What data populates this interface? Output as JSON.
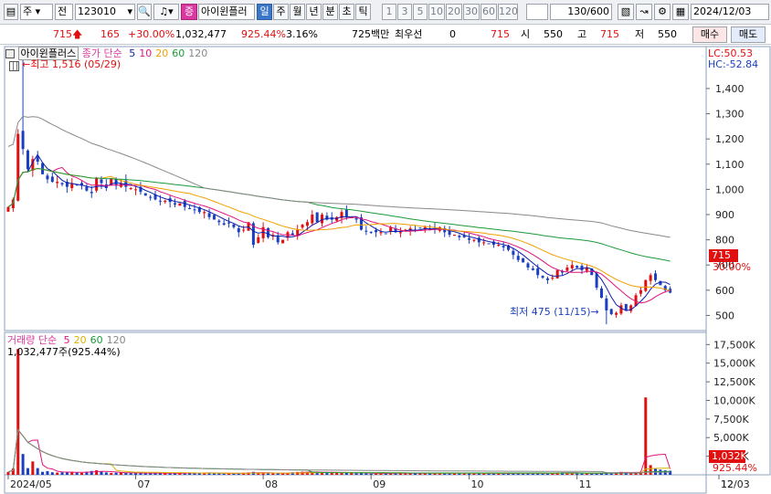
{
  "toolbar": {
    "mode1": "주",
    "mode2": "전",
    "code": "123010",
    "market_badge": "증",
    "name": "아이윈플러",
    "periods": [
      "일",
      "주",
      "월",
      "년",
      "분",
      "초",
      "틱"
    ],
    "active_period": "일",
    "intervals": [
      "1",
      "3",
      "5",
      "10",
      "20",
      "30",
      "60",
      "120"
    ],
    "count": "130/600",
    "date": "2024/12/03"
  },
  "quote": {
    "price": "715",
    "change": "165",
    "change_pct": "+30.00%",
    "volume": "1,032,477",
    "volume_ratio": "925.44%",
    "turnover_rate": "3.16%",
    "amount": "725백만",
    "pref_label": "최우선",
    "pref_value": "0",
    "ask": "715",
    "open_label": "시",
    "open": "550",
    "high_label": "고",
    "high": "715",
    "low_label": "저",
    "low": "550",
    "buy": "매수",
    "sell": "매도"
  },
  "price_legend": {
    "name": "아이윈플러스",
    "ma_label": "종가 단순",
    "ma": [
      {
        "period": "5",
        "color": "#0f1fb0"
      },
      {
        "period": "10",
        "color": "#e0157a"
      },
      {
        "period": "20",
        "color": "#f0a000"
      },
      {
        "period": "60",
        "color": "#1a9a3a"
      },
      {
        "period": "120",
        "color": "#888888"
      }
    ],
    "lc": "LC:50.53",
    "hc": "HC:-52.84",
    "high_note": "최고 1,516 (05/29)",
    "low_note": "최저 475 (11/15)",
    "last_price": "715",
    "last_pct": "30.00%"
  },
  "volume_legend": {
    "label": "거래량",
    "ma_label": "단순",
    "ma": [
      {
        "period": "5",
        "color": "#e0157a"
      },
      {
        "period": "20",
        "color": "#d9b400"
      },
      {
        "period": "60",
        "color": "#1a9a3a"
      },
      {
        "period": "120",
        "color": "#888888"
      }
    ],
    "current": "1,032,477주(925.44%)",
    "last_volume": "1,032K",
    "last_pct": "925.44%"
  },
  "colors": {
    "up": "#e01010",
    "down": "#1a3fc0",
    "panel_border": "#8fa0bc"
  },
  "chart_data": {
    "type": "candlestick",
    "price_axis": {
      "ticks": [
        500,
        600,
        700,
        800,
        900,
        1000,
        1100,
        1200,
        1300,
        1400
      ],
      "labels": [
        "500",
        "600",
        "700",
        "800",
        "900",
        "1,000",
        "1,100",
        "1,200",
        "1,300",
        "1,400"
      ],
      "range": [
        440,
        1570
      ]
    },
    "volume_axis": {
      "ticks": [
        0,
        2500,
        5000,
        7500,
        10000,
        12500,
        15000,
        17500
      ],
      "labels": [
        "0",
        "2,500K",
        "5,000K",
        "7,500K",
        "10,000K",
        "12,500K",
        "15,000K",
        "17,500K"
      ],
      "range": [
        0,
        18400
      ]
    },
    "x_labels": [
      "2024/05",
      "07",
      "08",
      "09",
      "10",
      "11",
      "12",
      "12/03"
    ],
    "x_label_index": [
      0,
      26,
      52,
      74,
      94,
      116,
      136,
      148
    ],
    "n": 136,
    "high_index": 3,
    "high_value": 1516,
    "low_index": 122,
    "low_value": 475,
    "close": [
      930,
      960,
      1220,
      1160,
      1080,
      1120,
      1110,
      1060,
      1040,
      1030,
      1030,
      1020,
      1010,
      1025,
      1015,
      1015,
      995,
      985,
      1045,
      1025,
      1005,
      1045,
      1015,
      1025,
      1010,
      1005,
      1000,
      990,
      975,
      970,
      960,
      955,
      955,
      950,
      940,
      945,
      930,
      925,
      920,
      910,
      910,
      890,
      880,
      870,
      860,
      865,
      850,
      830,
      840,
      870,
      780,
      810,
      850,
      810,
      820,
      790,
      800,
      830,
      820,
      840,
      860,
      870,
      900,
      870,
      900,
      880,
      880,
      890,
      910,
      890,
      890,
      880,
      840,
      835,
      830,
      830,
      830,
      825,
      850,
      830,
      830,
      840,
      845,
      840,
      845,
      850,
      840,
      840,
      850,
      830,
      820,
      820,
      810,
      810,
      800,
      800,
      790,
      790,
      785,
      780,
      780,
      770,
      760,
      740,
      720,
      710,
      690,
      680,
      660,
      650,
      640,
      650,
      680,
      670,
      690,
      700,
      690,
      680,
      690,
      660,
      610,
      570,
      520,
      505,
      510,
      540,
      520,
      540,
      580,
      600,
      640,
      660,
      640,
      620,
      600,
      590,
      560,
      715
    ],
    "volume": [
      380,
      850,
      16900,
      2800,
      900,
      1800,
      900,
      400,
      500,
      340,
      300,
      340,
      380,
      420,
      300,
      260,
      420,
      520,
      620,
      430,
      320,
      260,
      280,
      320,
      260,
      230,
      220,
      280,
      200,
      220,
      240,
      220,
      180,
      200,
      190,
      220,
      230,
      300,
      250,
      240,
      230,
      260,
      250,
      190,
      170,
      200,
      200,
      210,
      240,
      330,
      400,
      230,
      250,
      220,
      200,
      210,
      200,
      210,
      340,
      380,
      420,
      400,
      380,
      300,
      270,
      380,
      380,
      300,
      260,
      300,
      250,
      220,
      260,
      180,
      140,
      180,
      220,
      200,
      230,
      220,
      210,
      220,
      240,
      220,
      240,
      220,
      200,
      200,
      220,
      240,
      210,
      240,
      260,
      220,
      200,
      180,
      200,
      210,
      200,
      180,
      170,
      160,
      190,
      230,
      260,
      200,
      190,
      200,
      210,
      190,
      220,
      230,
      320,
      330,
      260,
      230,
      200,
      180,
      200,
      190,
      240,
      280,
      320,
      260,
      300,
      400,
      310,
      280,
      300,
      420,
      10400,
      1300,
      800,
      700,
      600,
      550,
      480,
      1032
    ],
    "series": [
      {
        "name": "5",
        "values": []
      },
      {
        "name": "10",
        "values": []
      },
      {
        "name": "20",
        "values": []
      },
      {
        "name": "60",
        "values": []
      },
      {
        "name": "120",
        "values": []
      }
    ]
  }
}
